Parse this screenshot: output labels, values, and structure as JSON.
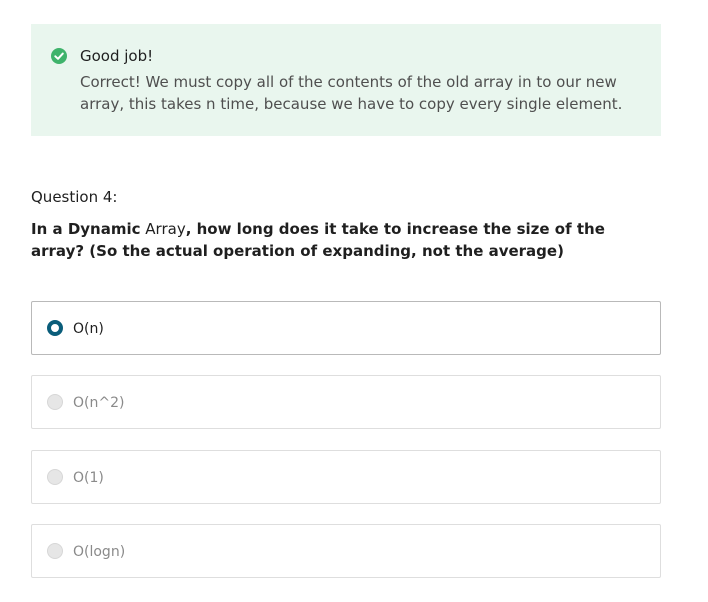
{
  "feedback": {
    "title": "Good job!",
    "message": "Correct! We must copy all of the contents of the old array in to our new array, this takes n time, because we have to copy every single element.",
    "status_color": "#3fb36b"
  },
  "question": {
    "number_label": "Question 4:",
    "text_prefix": "In a ",
    "text_emphasis": "Dynamic",
    "text_middle": " Array",
    "text_suffix": ", how long does it take to increase the size of the array? (So the actual operation of expanding, not the average)"
  },
  "options": [
    {
      "label": "O(n)",
      "selected": true
    },
    {
      "label": "O(n^2)",
      "selected": false
    },
    {
      "label": "O(1)",
      "selected": false
    },
    {
      "label": "O(logn)",
      "selected": false
    }
  ],
  "colors": {
    "selected_radio": "#0a5d7a",
    "feedback_bg": "#e9f6ee"
  }
}
